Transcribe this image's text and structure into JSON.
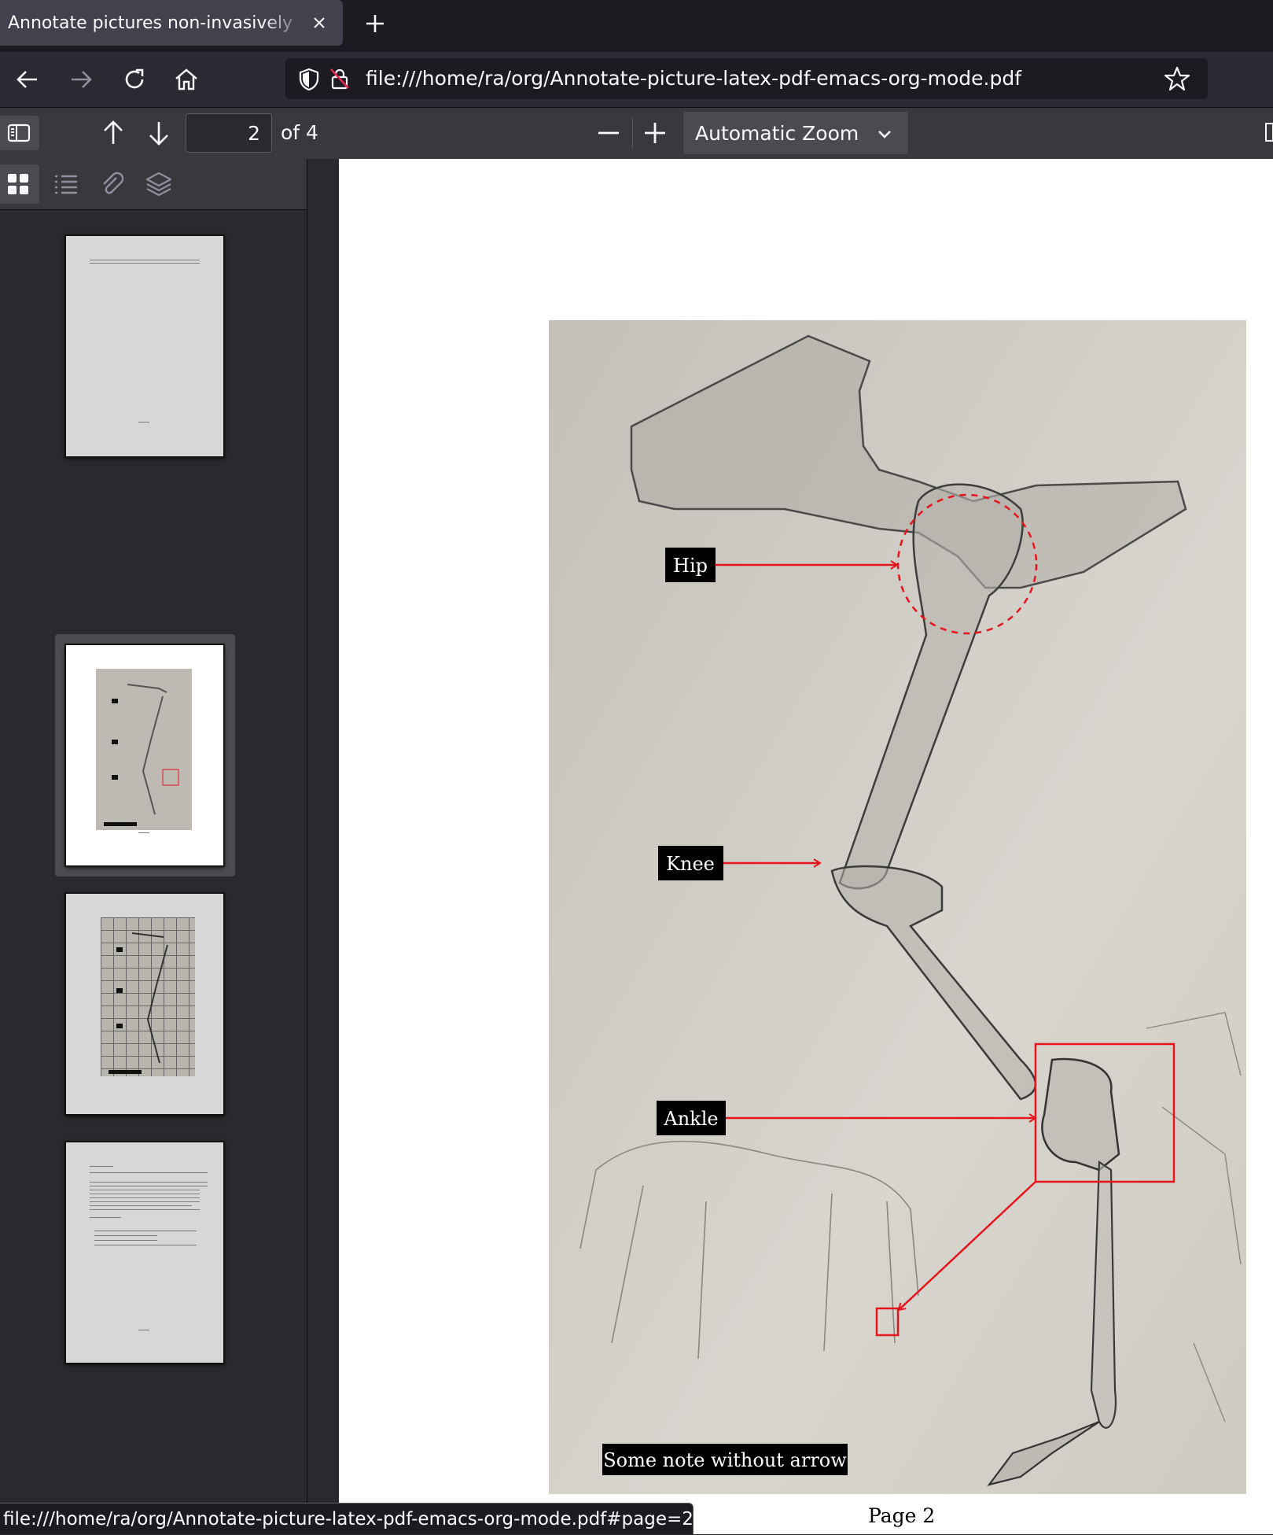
{
  "browser": {
    "tab_title": "Annotate pictures non-invasively",
    "url": "file:///home/ra/org/Annotate-picture-latex-pdf-emacs-org-mode.pdf",
    "status_url": "file:///home/ra/org/Annotate-picture-latex-pdf-emacs-org-mode.pdf#page=2",
    "icons": [
      "close-icon",
      "plus-icon",
      "back-icon",
      "forward-icon",
      "reload-icon",
      "home-icon",
      "shield-icon",
      "insecure-lock-icon",
      "star-icon"
    ]
  },
  "pdf_toolbar": {
    "page_number": "2",
    "page_count": "of 4",
    "zoom": "Automatic Zoom",
    "zoom_options": [
      "Automatic Zoom"
    ]
  },
  "sidebar": {
    "selected_page": 2,
    "thumbnails": [
      {
        "page": 1,
        "kind": "text"
      },
      {
        "page": 2,
        "kind": "annotated-figure"
      },
      {
        "page": 3,
        "kind": "annotated-figure-with-grid"
      },
      {
        "page": 4,
        "kind": "code-listing"
      }
    ]
  },
  "document": {
    "page_label": "Page 2",
    "figure": {
      "annotations": [
        {
          "label": "Hip",
          "marker": "dashed-circle"
        },
        {
          "label": "Knee",
          "marker": "arrow"
        },
        {
          "label": "Ankle",
          "marker": "rectangle-with-zoom-link"
        }
      ],
      "note": "Some note without arrow",
      "annotation_color": "#e8141b"
    }
  }
}
